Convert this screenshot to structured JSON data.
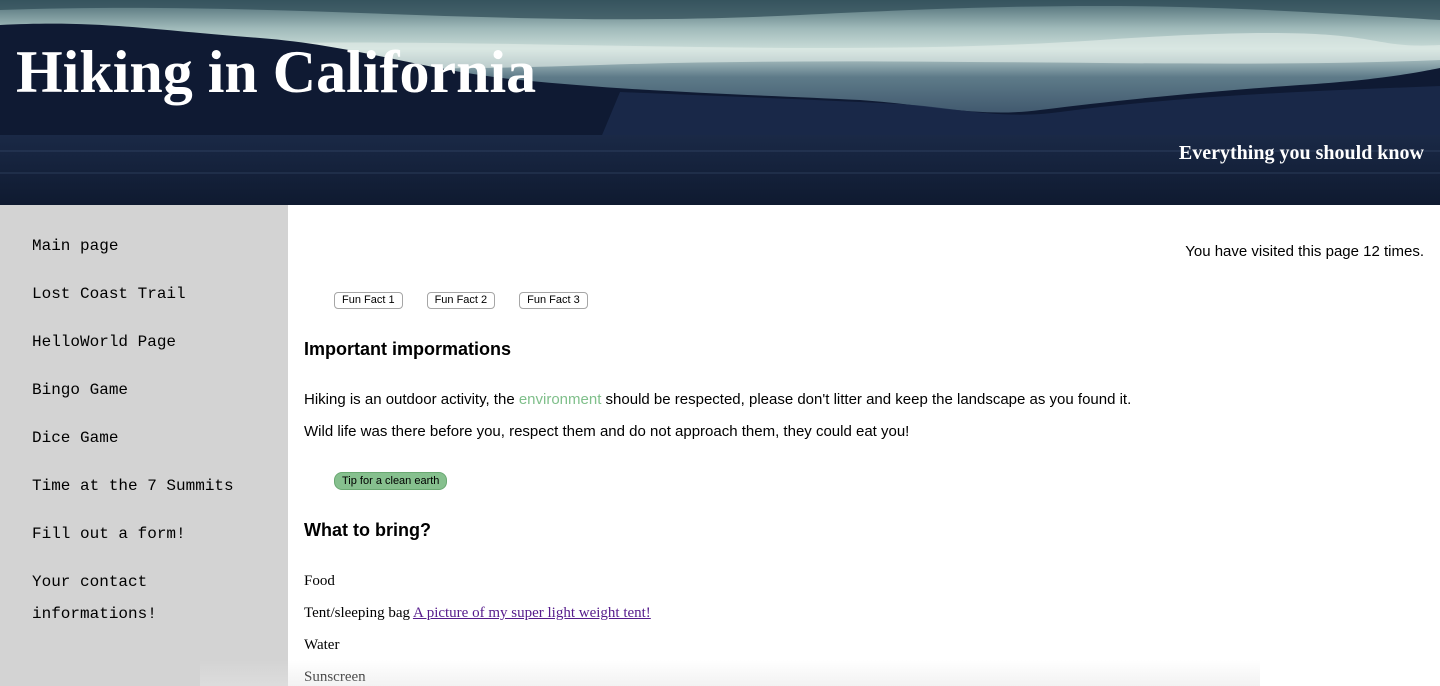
{
  "header": {
    "title": "Hiking in California",
    "subtitle": "Everything you should know"
  },
  "sidebar": {
    "items": [
      {
        "label": "Main page"
      },
      {
        "label": "Lost Coast Trail"
      },
      {
        "label": "HelloWorld Page"
      },
      {
        "label": "Bingo Game"
      },
      {
        "label": "Dice Game"
      },
      {
        "label": "Time at the 7 Summits"
      },
      {
        "label": "Fill out a form!"
      },
      {
        "label": "Your contact informations!"
      }
    ]
  },
  "main": {
    "visits_text": "You have visited this page 12 times.",
    "fun_facts": [
      {
        "label": "Fun Fact 1"
      },
      {
        "label": "Fun Fact 2"
      },
      {
        "label": "Fun Fact 3"
      }
    ],
    "section1": {
      "heading": "Important impormations",
      "para1_before": "Hiking is an outdoor activity, the ",
      "para1_highlight": "environment",
      "para1_after": " should be respected, please don't litter and keep the landscape as you found it.",
      "para2": "Wild life was there before you, respect them and do not approach them, they could eat you!",
      "tip_button": "Tip for a clean earth"
    },
    "section2": {
      "heading": "What to bring?",
      "items": [
        {
          "text": "Food"
        },
        {
          "text": "Tent/sleeping bag ",
          "link": "A picture of my super light weight tent!"
        },
        {
          "text": "Water"
        },
        {
          "text": "Sunscreen"
        }
      ]
    }
  },
  "colors": {
    "sidebar_bg": "#d3d3d3",
    "highlight_green": "#7fbf8a",
    "tip_button_bg": "#86c08e",
    "visited_link": "#551a8b"
  }
}
